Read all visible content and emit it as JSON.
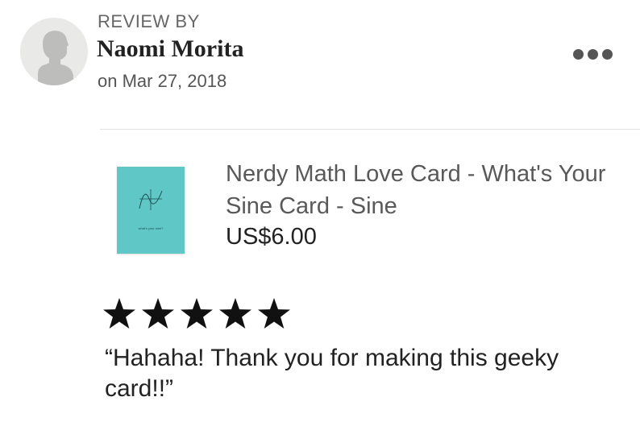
{
  "review": {
    "label": "REVIEW BY",
    "reviewer_name": "Naomi Morita",
    "date": "on Mar 27, 2018",
    "rating": 5,
    "max_rating": 5,
    "text": "“Hahaha! Thank you for making this geeky card!!”"
  },
  "listing": {
    "title": "Nerdy Math Love Card - What's Your Sine Card - Sine",
    "price": "US$6.00",
    "thumbnail_caption": "what's your sine?"
  },
  "icons": {
    "avatar": "default-user-silhouette-icon",
    "more": "more-options-icon",
    "star": "star-filled-icon"
  },
  "colors": {
    "avatar_bg": "#e9e9e7",
    "card_bg": "#5fc7c6",
    "star": "#111111",
    "more_dots": "#555555"
  }
}
